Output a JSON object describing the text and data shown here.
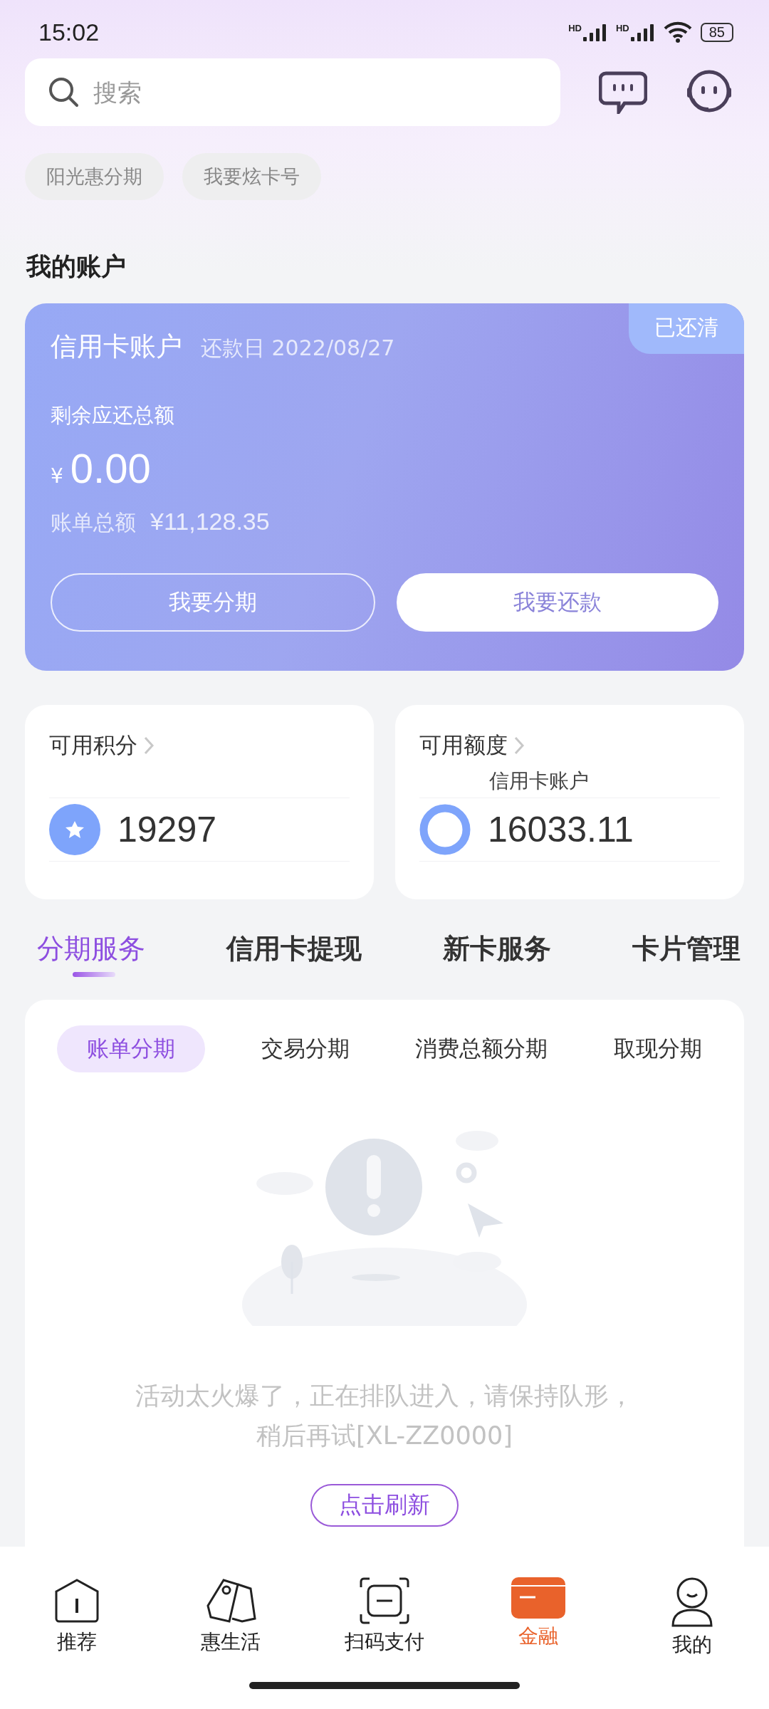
{
  "status_bar": {
    "time": "15:02",
    "network_labels": [
      "HD",
      "HD"
    ],
    "battery": "85"
  },
  "search": {
    "placeholder": "搜索"
  },
  "quick_tags": [
    "阳光惠分期",
    "我要炫卡号"
  ],
  "section_title": "我的账户",
  "account_card": {
    "title": "信用卡账户",
    "due_label": "还款日 2022/08/27",
    "badge": "已还清",
    "remaining_label": "剩余应还总额",
    "currency": "¥",
    "remaining": "0.00",
    "bill_label": "账单总额",
    "bill_amount": "¥11,128.35",
    "buttons": [
      {
        "label": "我要分期",
        "kind": "outline"
      },
      {
        "label": "我要还款",
        "kind": "solid"
      }
    ]
  },
  "summary_cards": [
    {
      "title": "可用积分",
      "kind": "points",
      "value": "19297"
    },
    {
      "title": "可用额度",
      "kind": "credit",
      "subtitle": "信用卡账户",
      "value": "16033.11"
    }
  ],
  "service_tabs": [
    {
      "label": "分期服务",
      "selected": true
    },
    {
      "label": "信用卡提现",
      "selected": false
    },
    {
      "label": "新卡服务",
      "selected": false
    },
    {
      "label": "卡片管理",
      "selected": false
    }
  ],
  "installment_tabs": [
    {
      "label": "账单分期",
      "selected": true
    },
    {
      "label": "交易分期",
      "selected": false
    },
    {
      "label": "消费总额分期",
      "selected": false
    },
    {
      "label": "取现分期",
      "selected": false
    }
  ],
  "empty_state": {
    "message": "活动太火爆了，正在排队进入，请保持队形，稍后再试[XL-ZZ0000]",
    "button": "点击刷新"
  },
  "bottom_nav": [
    {
      "label": "推荐",
      "kind": "home",
      "selected": false
    },
    {
      "label": "惠生活",
      "kind": "tags",
      "selected": false
    },
    {
      "label": "扫码支付",
      "kind": "scan",
      "selected": false
    },
    {
      "label": "金融",
      "kind": "card",
      "selected": true
    },
    {
      "label": "我的",
      "kind": "person",
      "selected": false
    }
  ]
}
